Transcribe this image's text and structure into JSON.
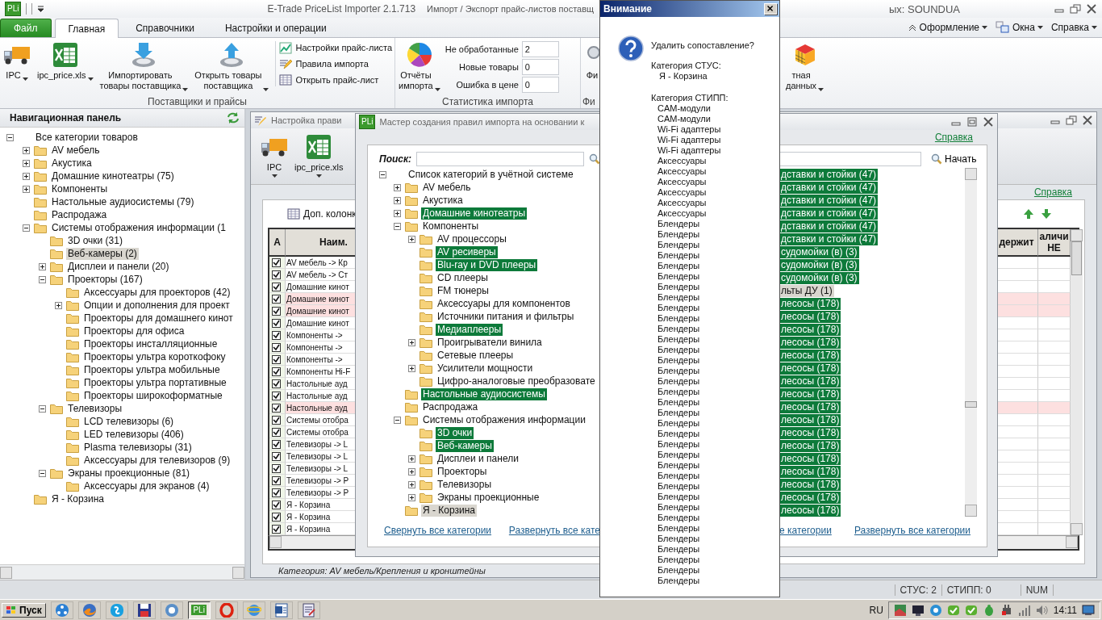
{
  "titlebar": {
    "logo": "PLi",
    "app_title": "E-Trade PriceList Importer 2.1.713",
    "document_title_start": "Импорт / Экспорт прайс-листов поставщ",
    "document_title_end": "ых: SOUNDUA"
  },
  "ribbon_tabs": [
    {
      "label": "Файл",
      "kind": "file",
      "selected": false
    },
    {
      "label": "Главная",
      "kind": "tab",
      "selected": true
    },
    {
      "label": "Справочники",
      "kind": "tab",
      "selected": false
    },
    {
      "label": "Настройки и операции",
      "kind": "tab",
      "selected": false
    }
  ],
  "ribbon_menus": [
    {
      "label": "Оформление",
      "kind": "collapse"
    },
    {
      "label": "Окна",
      "kind": "windows"
    },
    {
      "label": "Справка",
      "kind": "plain"
    }
  ],
  "ribbon_groups": [
    {
      "label": "Поставщики и прайсы",
      "large_buttons": [
        {
          "label": "IPC",
          "kind": "truck",
          "dropdown": true
        },
        {
          "label": "ipc_price.xls",
          "kind": "sheet",
          "dropdown": true
        },
        {
          "label": "Импортировать\nтовары поставщика",
          "kind": "import",
          "dropdown": true
        },
        {
          "label": "Открыть товары\nпоставщика",
          "kind": "export",
          "dropdown": true
        }
      ],
      "small_buttons": [
        {
          "label": "Настройки прайс-листа",
          "kind": "graph"
        },
        {
          "label": "Правила импорта",
          "kind": "pen"
        },
        {
          "label": "Открыть прайс-лист",
          "kind": "grid"
        }
      ]
    },
    {
      "label": "Статистика импорта",
      "large_buttons": [
        {
          "label": "Отчёты\nимпорта",
          "kind": "pie",
          "dropdown": true
        }
      ],
      "stats": [
        {
          "label": "Не обработанные",
          "value": "2"
        },
        {
          "label": "Новые товары",
          "value": "0"
        },
        {
          "label": "Ошибка в цене",
          "value": "0"
        }
      ]
    },
    {
      "label": "Фи",
      "large_buttons": [
        {
          "label": "Фи",
          "kind": "lens",
          "dropdown": false
        },
        {
          "label": "тная\nданных",
          "kind": "cube",
          "dropdown": true
        }
      ]
    }
  ],
  "navigation_panel": {
    "title": "Навигационная панель",
    "tree": [
      {
        "label": "Все категории товаров",
        "expanded": true,
        "selected": false,
        "children": [
          {
            "label": "AV мебель",
            "expanded": false,
            "selected": false
          },
          {
            "label": "Акустика",
            "expanded": false,
            "selected": false
          },
          {
            "label": "Домашние кинотеатры (75)",
            "expanded": false,
            "selected": false
          },
          {
            "label": "Компоненты",
            "expanded": false,
            "selected": false
          },
          {
            "label": "Настольные аудиосистемы (79)",
            "selected": false
          },
          {
            "label": "Распродажа",
            "selected": false
          },
          {
            "label": "Системы отображения информации (1",
            "expanded": true,
            "selected": false,
            "children": [
              {
                "label": "3D очки (31)",
                "selected": false
              },
              {
                "label": "Веб-камеры (2)",
                "selected": true
              },
              {
                "label": "Дисплеи и панели (20)",
                "expanded": false,
                "selected": false
              },
              {
                "label": "Проекторы (167)",
                "expanded": true,
                "selected": false,
                "children": [
                  {
                    "label": "Аксессуары для проекторов (42)",
                    "selected": false
                  },
                  {
                    "label": "Опции и дополнения для проект",
                    "expanded": false,
                    "selected": false
                  },
                  {
                    "label": "Проекторы для домашнего кинот",
                    "selected": false
                  },
                  {
                    "label": "Проекторы для офиса",
                    "selected": false
                  },
                  {
                    "label": "Проекторы инсталляционные",
                    "selected": false
                  },
                  {
                    "label": "Проекторы ультра короткофоку",
                    "selected": false
                  },
                  {
                    "label": "Проекторы ультра мобильные",
                    "selected": false
                  },
                  {
                    "label": "Проекторы ультра портативные",
                    "selected": false
                  },
                  {
                    "label": "Проекторы широкоформатные",
                    "selected": false
                  }
                ]
              },
              {
                "label": "Телевизоры",
                "expanded": true,
                "selected": false,
                "children": [
                  {
                    "label": "LCD телевизоры (6)",
                    "selected": false
                  },
                  {
                    "label": "LED телевизоры (406)",
                    "selected": false
                  },
                  {
                    "label": "Plasma телевизоры (31)",
                    "selected": false
                  },
                  {
                    "label": "Аксессуары для телевизоров (9)",
                    "selected": false
                  }
                ]
              },
              {
                "label": "Экраны проекционные (81)",
                "expanded": true,
                "selected": false,
                "children": [
                  {
                    "label": "Аксессуары для экранов (4)",
                    "selected": false
                  }
                ]
              }
            ]
          },
          {
            "label": "Я - Корзина",
            "selected": false
          }
        ]
      }
    ]
  },
  "settings_window": {
    "title": "Настройка прави",
    "toolbar": [
      {
        "label": "IPC",
        "kind": "truck"
      },
      {
        "label": "ipc_price.xls",
        "kind": "sheet"
      }
    ],
    "help_link": "Справка",
    "columns_button": "Доп. колонк",
    "table": {
      "columns": [
        "A",
        "Наим.",
        "держит",
        "аличи НЕ"
      ],
      "rows": [
        {
          "checked": true,
          "name": "AV мебель -> Кр",
          "highlighted": false
        },
        {
          "checked": true,
          "name": "AV мебель -> Ст",
          "highlighted": false
        },
        {
          "checked": true,
          "name": "Домашние кинот",
          "highlighted": false
        },
        {
          "checked": true,
          "name": "Домашние кинот",
          "highlighted": true
        },
        {
          "checked": true,
          "name": "Домашние кинот",
          "highlighted": true
        },
        {
          "checked": true,
          "name": "Домашние кинот",
          "highlighted": false
        },
        {
          "checked": true,
          "name": "Компоненты ->",
          "highlighted": false
        },
        {
          "checked": true,
          "name": "Компоненты ->",
          "highlighted": false
        },
        {
          "checked": true,
          "name": "Компоненты ->",
          "highlighted": false
        },
        {
          "checked": true,
          "name": "Компоненты Hi-F",
          "highlighted": false
        },
        {
          "checked": true,
          "name": "Настольные ауд",
          "highlighted": false
        },
        {
          "checked": true,
          "name": "Настольные ауд",
          "highlighted": false
        },
        {
          "checked": true,
          "name": "Настольные ауд",
          "highlighted": true
        },
        {
          "checked": true,
          "name": "Системы отобра",
          "highlighted": false
        },
        {
          "checked": true,
          "name": "Системы отобра",
          "highlighted": false
        },
        {
          "checked": true,
          "name": "Телевизоры -> L",
          "highlighted": false
        },
        {
          "checked": true,
          "name": "Телевизоры -> L",
          "highlighted": false
        },
        {
          "checked": true,
          "name": "Телевизоры -> L",
          "highlighted": false
        },
        {
          "checked": true,
          "name": "Телевизоры -> P",
          "highlighted": false
        },
        {
          "checked": true,
          "name": "Телевизоры -> P",
          "highlighted": false
        },
        {
          "checked": true,
          "name": "Я - Корзина",
          "highlighted": false
        },
        {
          "checked": true,
          "name": "Я - Корзина",
          "highlighted": false
        },
        {
          "checked": true,
          "name": "Я - Корзина",
          "highlighted": false
        }
      ]
    },
    "status": "Категория: AV мебель/Крепления и кронштейны"
  },
  "wizard_window": {
    "logo": "PLi",
    "title": "Мастер создания правил импорта на основании к",
    "help_link": "Справка",
    "left_pane": {
      "search_label": "Поиск:",
      "tree": [
        {
          "label": "Список категорий в учётной системе",
          "expanded": true,
          "mapped": false,
          "selected": false,
          "children": [
            {
              "label": "AV мебель",
              "expanded": false,
              "mapped": false,
              "selected": false
            },
            {
              "label": "Акустика",
              "expanded": false,
              "mapped": false,
              "selected": false
            },
            {
              "label": "Домашние кинотеатры",
              "expanded": false,
              "mapped": true,
              "selected": false
            },
            {
              "label": "Компоненты",
              "expanded": true,
              "mapped": false,
              "selected": false,
              "children": [
                {
                  "label": "AV процессоры",
                  "expanded": false,
                  "mapped": false,
                  "selected": false
                },
                {
                  "label": "AV ресиверы",
                  "mapped": true,
                  "selected": false
                },
                {
                  "label": "Blu-ray и DVD плееры",
                  "mapped": true,
                  "selected": false
                },
                {
                  "label": "CD плееры",
                  "mapped": false,
                  "selected": false
                },
                {
                  "label": "FM тюнеры",
                  "mapped": false,
                  "selected": false
                },
                {
                  "label": "Аксессуары для компонентов",
                  "mapped": false,
                  "selected": false
                },
                {
                  "label": "Источники питания и фильтры",
                  "mapped": false,
                  "selected": false
                },
                {
                  "label": "Медиаплееры",
                  "mapped": true,
                  "selected": false
                },
                {
                  "label": "Проигрыватели винила",
                  "expanded": false,
                  "mapped": false,
                  "selected": false
                },
                {
                  "label": "Сетевые плееры",
                  "mapped": false,
                  "selected": false
                },
                {
                  "label": "Усилители мощности",
                  "expanded": false,
                  "mapped": false,
                  "selected": false
                },
                {
                  "label": "Цифро-аналоговые преобразовате",
                  "mapped": false,
                  "selected": false
                }
              ]
            },
            {
              "label": "Настольные аудиосистемы",
              "mapped": true,
              "selected": false
            },
            {
              "label": "Распродажа",
              "mapped": false,
              "selected": false
            },
            {
              "label": "Системы отображения информации",
              "expanded": true,
              "mapped": false,
              "selected": false,
              "children": [
                {
                  "label": "3D очки",
                  "mapped": true,
                  "selected": false
                },
                {
                  "label": "Веб-камеры",
                  "mapped": true,
                  "selected": false
                },
                {
                  "label": "Дисплеи и панели",
                  "expanded": false,
                  "mapped": false,
                  "selected": false
                },
                {
                  "label": "Проекторы",
                  "expanded": false,
                  "mapped": false,
                  "selected": false
                },
                {
                  "label": "Телевизоры",
                  "expanded": false,
                  "mapped": false,
                  "selected": false
                },
                {
                  "label": "Экраны проекционные",
                  "expanded": false,
                  "mapped": false,
                  "selected": false
                }
              ]
            },
            {
              "label": "Я - Корзина",
              "mapped": false,
              "selected": true
            }
          ]
        }
      ],
      "collapse_link": "Свернуть все категории",
      "expand_link": "Развернуть все кате"
    },
    "right_pane": {
      "search_button": "Начать",
      "rows": [
        {
          "label": "дставки и стойки (47)",
          "mapped": true,
          "selected": false
        },
        {
          "label": "дставки и стойки (47)",
          "mapped": true,
          "selected": false
        },
        {
          "label": "дставки и стойки (47)",
          "mapped": true,
          "selected": false
        },
        {
          "label": "дставки и стойки (47)",
          "mapped": true,
          "selected": false
        },
        {
          "label": "дставки и стойки (47)",
          "mapped": true,
          "selected": false
        },
        {
          "label": "дставки и стойки (47)",
          "mapped": true,
          "selected": false
        },
        {
          "label": "судомойки (в) (3)",
          "mapped": true,
          "selected": false
        },
        {
          "label": "судомойки (в) (3)",
          "mapped": true,
          "selected": false
        },
        {
          "label": "судомойки (в) (3)",
          "mapped": true,
          "selected": false
        },
        {
          "label": "льты ДУ (1)",
          "mapped": false,
          "selected": true
        },
        {
          "label": "лесосы (178)",
          "mapped": true,
          "selected": false
        },
        {
          "label": "лесосы (178)",
          "mapped": true,
          "selected": false
        },
        {
          "label": "лесосы (178)",
          "mapped": true,
          "selected": false
        },
        {
          "label": "лесосы (178)",
          "mapped": true,
          "selected": false
        },
        {
          "label": "лесосы (178)",
          "mapped": true,
          "selected": false
        },
        {
          "label": "лесосы (178)",
          "mapped": true,
          "selected": false
        },
        {
          "label": "лесосы (178)",
          "mapped": true,
          "selected": false
        },
        {
          "label": "лесосы (178)",
          "mapped": true,
          "selected": false
        },
        {
          "label": "лесосы (178)",
          "mapped": true,
          "selected": false
        },
        {
          "label": "лесосы (178)",
          "mapped": true,
          "selected": false
        },
        {
          "label": "лесосы (178)",
          "mapped": true,
          "selected": false
        },
        {
          "label": "лесосы (178)",
          "mapped": true,
          "selected": false
        },
        {
          "label": "лесосы (178)",
          "mapped": true,
          "selected": false
        },
        {
          "label": "лесосы (178)",
          "mapped": true,
          "selected": false
        },
        {
          "label": "лесосы (178)",
          "mapped": true,
          "selected": false
        },
        {
          "label": "лесосы (178)",
          "mapped": true,
          "selected": false
        },
        {
          "label": "лесосы (178)",
          "mapped": true,
          "selected": false
        }
      ],
      "collapse_link": "е категории",
      "expand_link": "Развернуть все категории"
    }
  },
  "dialog": {
    "title": "Внимание",
    "question": "Удалить сопоставление?",
    "source_label": "Категория СТУС:",
    "source_items": [
      "Я - Корзина"
    ],
    "target_label": "Категория СТИПП:",
    "target_items": [
      "CAM-модули",
      "CAM-модули",
      "Wi-Fi адаптеры",
      "Wi-Fi адаптеры",
      "Wi-Fi адаптеры",
      "Аксессуары",
      "Аксессуары",
      "Аксессуары",
      "Аксессуары",
      "Аксессуары",
      "Аксессуары",
      "Блендеры",
      "Блендеры",
      "Блендеры",
      "Блендеры",
      "Блендеры",
      "Блендеры",
      "Блендеры",
      "Блендеры",
      "Блендеры",
      "Блендеры",
      "Блендеры",
      "Блендеры",
      "Блендеры",
      "Блендеры",
      "Блендеры",
      "Блендеры",
      "Блендеры",
      "Блендеры",
      "Блендеры",
      "Блендеры",
      "Блендеры",
      "Блендеры",
      "Блендеры",
      "Блендеры",
      "Блендеры",
      "Блендеры",
      "Блендеры",
      "Блендеры",
      "Блендеры",
      "Блендеры",
      "Блендеры",
      "Блендеры",
      "Блендеры",
      "Блендеры",
      "Блендеры"
    ]
  },
  "status_bar": {
    "segments": [
      "СТУС: 2",
      "СТИПП: 0",
      "NUM"
    ]
  },
  "taskbar": {
    "start": "Пуск",
    "buttons": [
      {
        "kind": "globe",
        "selected": false
      },
      {
        "kind": "fox",
        "selected": false
      },
      {
        "kind": "chat",
        "selected": false
      },
      {
        "kind": "floppy",
        "selected": false
      },
      {
        "kind": "sphere",
        "selected": false
      },
      {
        "kind": "logo",
        "label": "PLi",
        "selected": true
      },
      {
        "kind": "ring",
        "selected": false
      },
      {
        "kind": "orb",
        "selected": false
      },
      {
        "kind": "page",
        "selected": false
      },
      {
        "kind": "doc",
        "selected": false
      }
    ],
    "language": "RU",
    "clock": "14:11"
  }
}
